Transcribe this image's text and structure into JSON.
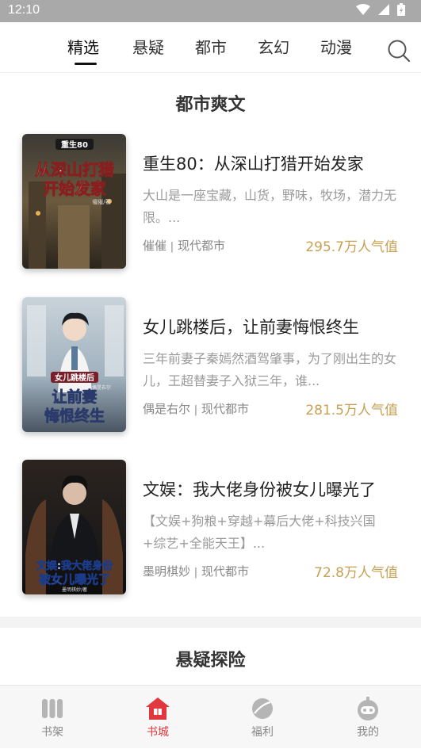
{
  "status_bar": {
    "time": "12:10"
  },
  "tabs": [
    {
      "label": "精选",
      "active": true
    },
    {
      "label": "悬疑",
      "active": false
    },
    {
      "label": "都市",
      "active": false
    },
    {
      "label": "玄幻",
      "active": false
    },
    {
      "label": "动漫",
      "active": false
    }
  ],
  "section_1": {
    "title": "都市爽文"
  },
  "books": [
    {
      "title": "重生80：从深山打猎开始发家",
      "desc": "大山是一座宝藏，山货，野味，牧场，潜力无限。...",
      "author": "催催",
      "category": "现代都市",
      "popularity": "295.7万人气值",
      "cover_lines": [
        "重生80",
        "从深山打猎",
        "开始发家"
      ],
      "cover_author": "催催/著"
    },
    {
      "title": "女儿跳楼后，让前妻悔恨终生",
      "desc": "三年前妻子秦嫣然酒驾肇事，为了刚出生的女儿，王超替妻子入狱三年，谁...",
      "author": "偶是右尔",
      "category": "现代都市",
      "popularity": "281.5万人气值",
      "cover_lines": [
        "女儿跳楼后",
        "让前妻",
        "悔恨终生"
      ],
      "cover_author": "偶是右尔"
    },
    {
      "title": "文娱：我大佬身份被女儿曝光了",
      "desc": "【文娱+狗粮+穿越+幕后大佬+科技兴国+综艺+全能天王】...",
      "author": "墨明棋妙",
      "category": "现代都市",
      "popularity": "72.8万人气值",
      "cover_lines": [
        "文娱:我大佬身份",
        "被女儿曝光了"
      ],
      "cover_author": "墨明棋妙/著"
    }
  ],
  "meta_separator": "|",
  "section_2": {
    "title": "悬疑探险"
  },
  "bottom_nav": [
    {
      "label": "书架",
      "icon": "bookshelf-icon",
      "active": false
    },
    {
      "label": "书城",
      "icon": "bookstore-icon",
      "active": true
    },
    {
      "label": "福利",
      "icon": "welfare-icon",
      "active": false
    },
    {
      "label": "我的",
      "icon": "profile-icon",
      "active": false
    }
  ],
  "colors": {
    "accent": "#e0383e",
    "popularity": "#c8a052",
    "status_bar": "#a9a9a9"
  }
}
